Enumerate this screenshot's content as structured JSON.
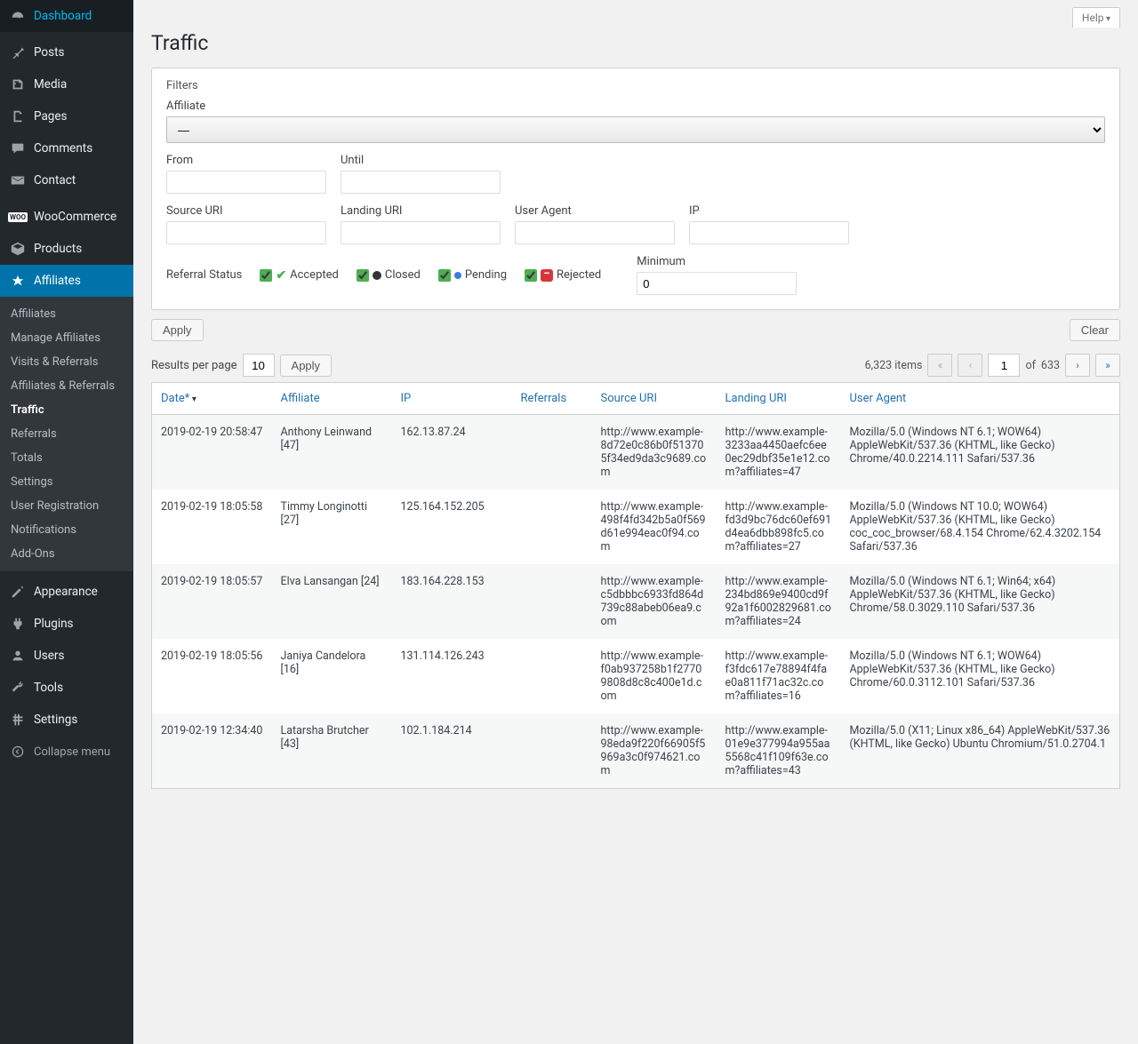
{
  "help_label": "Help",
  "page_title": "Traffic",
  "sidebar": {
    "main": [
      {
        "icon": "dashboard",
        "label": "Dashboard"
      },
      {
        "sep": true
      },
      {
        "icon": "pin",
        "label": "Posts"
      },
      {
        "icon": "media",
        "label": "Media"
      },
      {
        "icon": "page",
        "label": "Pages"
      },
      {
        "icon": "comment",
        "label": "Comments"
      },
      {
        "icon": "mail",
        "label": "Contact"
      },
      {
        "sep": true
      },
      {
        "icon": "woo",
        "label": "WooCommerce"
      },
      {
        "icon": "product",
        "label": "Products"
      },
      {
        "icon": "affiliates",
        "label": "Affiliates",
        "current": true
      },
      {
        "sep": true
      },
      {
        "icon": "appearance",
        "label": "Appearance"
      },
      {
        "icon": "plugin",
        "label": "Plugins"
      },
      {
        "icon": "users",
        "label": "Users"
      },
      {
        "icon": "tools",
        "label": "Tools"
      },
      {
        "icon": "settings",
        "label": "Settings"
      }
    ],
    "submenu": [
      {
        "label": "Affiliates"
      },
      {
        "label": "Manage Affiliates"
      },
      {
        "label": "Visits & Referrals"
      },
      {
        "label": "Affiliates & Referrals"
      },
      {
        "label": "Traffic",
        "active": true
      },
      {
        "label": "Referrals"
      },
      {
        "label": "Totals"
      },
      {
        "label": "Settings"
      },
      {
        "label": "User Registration"
      },
      {
        "label": "Notifications"
      },
      {
        "label": "Add-Ons"
      }
    ],
    "collapse_label": "Collapse menu"
  },
  "filters": {
    "title": "Filters",
    "affiliate_label": "Affiliate",
    "affiliate_value": "—",
    "from_label": "From",
    "until_label": "Until",
    "source_uri_label": "Source URI",
    "landing_uri_label": "Landing URI",
    "user_agent_label": "User Agent",
    "ip_label": "IP",
    "referral_status_label": "Referral Status",
    "status_accepted": "Accepted",
    "status_closed": "Closed",
    "status_pending": "Pending",
    "status_rejected": "Rejected",
    "minimum_label": "Minimum",
    "minimum_value": "0",
    "apply_label": "Apply",
    "clear_label": "Clear"
  },
  "results": {
    "results_per_page_label": "Results per page",
    "per_page_value": "10",
    "apply_label": "Apply",
    "total_items": "6,323 items",
    "current_page": "1",
    "of_label": "of",
    "total_pages": "633"
  },
  "table": {
    "headers": {
      "date": "Date*",
      "affiliate": "Affiliate",
      "ip": "IP",
      "referrals": "Referrals",
      "source_uri": "Source URI",
      "landing_uri": "Landing URI",
      "user_agent": "User Agent"
    },
    "rows": [
      {
        "date": "2019-02-19 20:58:47",
        "affiliate": "Anthony Leinwand [47]",
        "ip": "162.13.87.24",
        "referrals": "",
        "source_uri": "http://www.example-8d72e0c86b0f513705f34ed9da3c9689.com",
        "landing_uri": "http://www.example-3233aa4450aefc6ee0ec29dbf35e1e12.com?affiliates=47",
        "user_agent": "Mozilla/5.0 (Windows NT 6.1; WOW64) AppleWebKit/537.36 (KHTML, like Gecko) Chrome/40.0.2214.111 Safari/537.36"
      },
      {
        "date": "2019-02-19 18:05:58",
        "affiliate": "Timmy Longinotti [27]",
        "ip": "125.164.152.205",
        "referrals": "",
        "source_uri": "http://www.example-498f4fd342b5a0f569d61e994eac0f94.com",
        "landing_uri": "http://www.example-fd3d9bc76dc60ef691d4ea6dbb898fc5.com?affiliates=27",
        "user_agent": "Mozilla/5.0 (Windows NT 10.0; WOW64) AppleWebKit/537.36 (KHTML, like Gecko) coc_coc_browser/68.4.154 Chrome/62.4.3202.154 Safari/537.36"
      },
      {
        "date": "2019-02-19 18:05:57",
        "affiliate": "Elva Lansangan [24]",
        "ip": "183.164.228.153",
        "referrals": "",
        "source_uri": "http://www.example-c5dbbbc6933fd864d739c88abeb06ea9.com",
        "landing_uri": "http://www.example-234bd869e9400cd9f92a1f6002829681.com?affiliates=24",
        "user_agent": "Mozilla/5.0 (Windows NT 6.1; Win64; x64) AppleWebKit/537.36 (KHTML, like Gecko) Chrome/58.0.3029.110 Safari/537.36"
      },
      {
        "date": "2019-02-19 18:05:56",
        "affiliate": "Janiya Candelora [16]",
        "ip": "131.114.126.243",
        "referrals": "",
        "source_uri": "http://www.example-f0ab937258b1f27709808d8c8c400e1d.com",
        "landing_uri": "http://www.example-f3fdc617e78894f4fae0a811f71ac32c.com?affiliates=16",
        "user_agent": "Mozilla/5.0 (Windows NT 6.1; WOW64) AppleWebKit/537.36 (KHTML, like Gecko) Chrome/60.0.3112.101 Safari/537.36"
      },
      {
        "date": "2019-02-19 12:34:40",
        "affiliate": "Latarsha Brutcher [43]",
        "ip": "102.1.184.214",
        "referrals": "",
        "source_uri": "http://www.example-98eda9f220f66905f5969a3c0f974621.com",
        "landing_uri": "http://www.example-01e9e377994a955aa5568c41f109f63e.com?affiliates=43",
        "user_agent": "Mozilla/5.0 (X11; Linux x86_64) AppleWebKit/537.36 (KHTML, like Gecko) Ubuntu Chromium/51.0.2704.1"
      }
    ]
  }
}
